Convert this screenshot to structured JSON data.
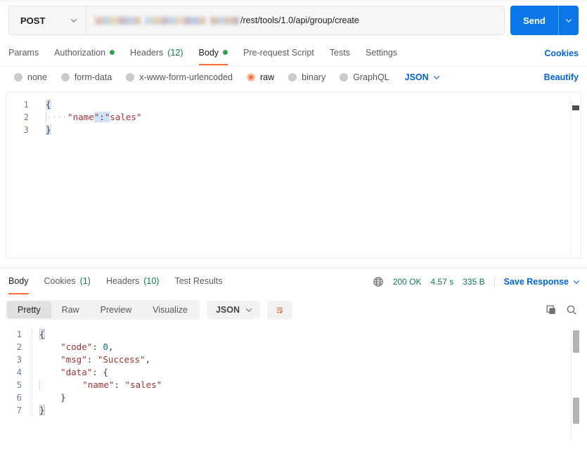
{
  "colors": {
    "accent_orange": "#FF6C37",
    "link_blue": "#0265D2",
    "send_button_blue": "#0B76E8",
    "status_green": "#0E7A5A",
    "dot_green": "#2DA44E",
    "code_string_red": "#A13434",
    "code_number_teal": "#0E7480"
  },
  "icons": {
    "method_chevron": "chevron-down-icon",
    "send_chevron": "chevron-down-icon",
    "network": "globe-icon",
    "wrap": "wrap-text-icon",
    "copy": "copy-icon",
    "search": "search-icon"
  },
  "request_bar": {
    "method": "POST",
    "url_visible_path": "/rest/tools/1.0/api/group/create",
    "send_label": "Send"
  },
  "request_tabs": {
    "items": [
      {
        "label": "Params"
      },
      {
        "label": "Authorization",
        "dot": true
      },
      {
        "label": "Headers",
        "count": "(12)"
      },
      {
        "label": "Body",
        "dot": true,
        "active": true
      },
      {
        "label": "Pre-request Script"
      },
      {
        "label": "Tests"
      },
      {
        "label": "Settings"
      }
    ],
    "cookies_link": "Cookies"
  },
  "body_type_row": {
    "options": [
      {
        "label": "none"
      },
      {
        "label": "form-data"
      },
      {
        "label": "x-www-form-urlencoded"
      },
      {
        "label": "raw",
        "selected": true
      },
      {
        "label": "binary"
      },
      {
        "label": "GraphQL"
      }
    ],
    "language": "JSON",
    "beautify_link": "Beautify"
  },
  "request_editor": {
    "line_numbers": [
      "1",
      "2",
      "3"
    ],
    "l1_open": "{",
    "l2_ws": "····",
    "l2_key": "\"name",
    "l2_sel_a": "\"",
    "l2_sel_colon": ":",
    "l2_sel_b": "\"",
    "l2_val": "sales\"",
    "l3_close": "}"
  },
  "response_header": {
    "tabs": [
      {
        "label": "Body",
        "active": true
      },
      {
        "label": "Cookies",
        "count": "(1)"
      },
      {
        "label": "Headers",
        "count": "(10)"
      },
      {
        "label": "Test Results"
      }
    ],
    "status": "200 OK",
    "time": "4.57 s",
    "size": "335 B",
    "save_response_label": "Save Response"
  },
  "response_toolbar": {
    "views": [
      {
        "label": "Pretty",
        "active": true
      },
      {
        "label": "Raw"
      },
      {
        "label": "Preview"
      },
      {
        "label": "Visualize"
      }
    ],
    "language": "JSON"
  },
  "response_editor": {
    "line_numbers": [
      "1",
      "2",
      "3",
      "4",
      "5",
      "6",
      "7"
    ],
    "l1_open": "{",
    "indent": "    ",
    "l2_key": "\"code\"",
    "l2_colon": ": ",
    "l2_num": "0",
    "l2_comma": ",",
    "l3_key": "\"msg\"",
    "l3_colon": ": ",
    "l3_str": "\"Success\"",
    "l3_comma": ",",
    "l4_key": "\"data\"",
    "l4_colon": ": ",
    "l4_open": "{",
    "l5_key": "\"name\"",
    "l5_colon": ": ",
    "l5_str": "\"sales\"",
    "l6_close": "}",
    "l7_close": "}"
  }
}
